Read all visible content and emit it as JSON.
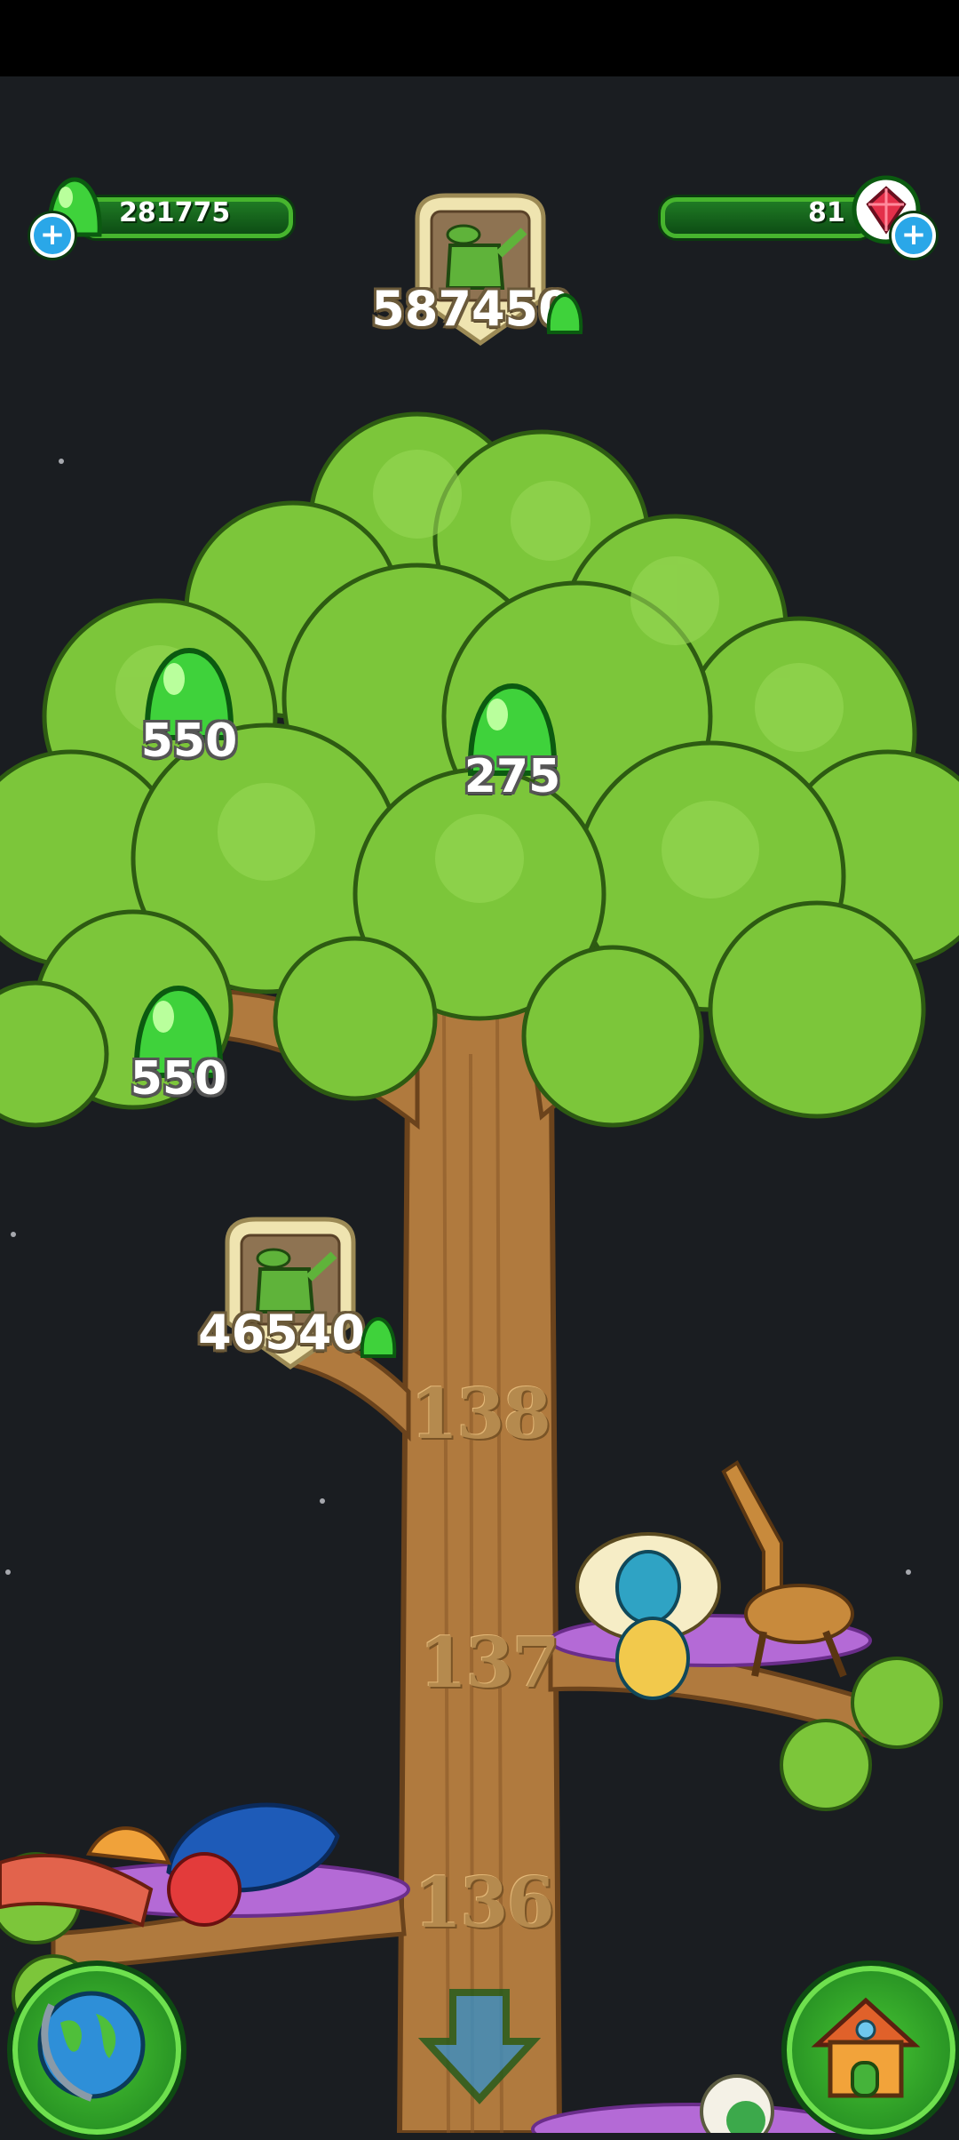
{
  "hud": {
    "jelly_count": "281775",
    "gem_count": "81",
    "add_jelly_label": "+",
    "add_gems_label": "+"
  },
  "tree": {
    "top_upgrade": {
      "price": "587450",
      "icon": "watering-can-icon"
    },
    "mid_upgrade": {
      "price": "46540",
      "icon": "watering-can-icon"
    },
    "jelly_pickups": [
      {
        "value": "550"
      },
      {
        "value": "275"
      },
      {
        "value": "550"
      }
    ],
    "levels": [
      "138",
      "137",
      "136"
    ]
  },
  "nav": {
    "left_button_icon": "globe-icon",
    "center_button_icon": "down-arrow-icon",
    "right_button_icon": "house-icon"
  },
  "colors": {
    "jelly_green": "#3fd23b",
    "leaf_green": "#7cc63a",
    "trunk_brown": "#b07a3e",
    "background": "#1a1d21"
  }
}
